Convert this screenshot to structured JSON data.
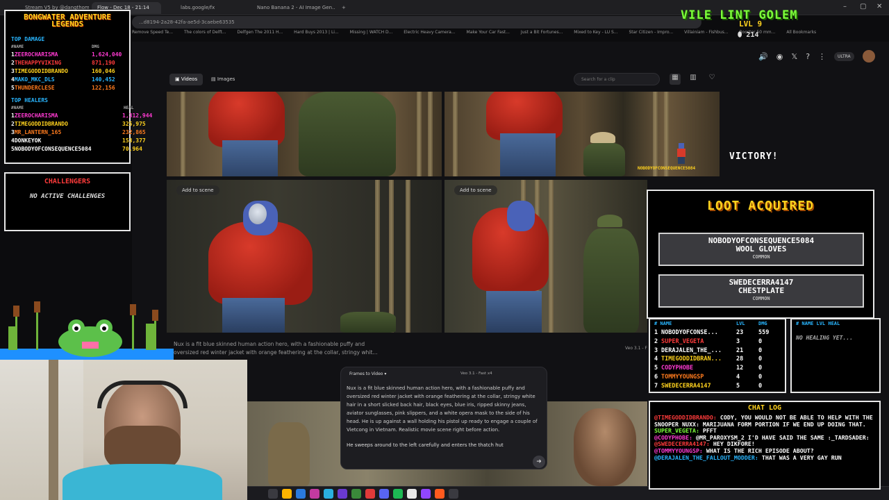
{
  "browser": {
    "tabs": [
      "Stream V5 by @dangthompson...",
      "Flow - Dec 18 - 21:14",
      "labs.google/fx",
      "Nano Banana 2 - AI Image Gen..."
    ],
    "url": "...d8194-2a28-42fa-ae5d-3caebe63535",
    "bookmarks": [
      "Remove Speed Te...",
      "The colors of Delft...",
      "Delfgen The 2011 H...",
      "Hard Buys 2013 | Li...",
      "Missing | WATCH D...",
      "Electric Heavy Camera...",
      "Make Your Car Fast...",
      "Just a Bit Fortunes...",
      "Mixed to Key - LU S...",
      "Star Citizen - Impro...",
      "Villainiam - Fishbus...",
      "Booster 50 mm..."
    ],
    "all_bookmarks": "All Bookmarks"
  },
  "app": {
    "tabs": {
      "videos": "Videos",
      "images": "Images"
    },
    "search_placeholder": "Search for a clip",
    "ultra_badge": "ULTRA",
    "add_to_scene": "Add to scene",
    "caption": "Nux is a fit blue skinned human action hero, with a fashionable puffy and oversized red winter jacket with orange feathering at the collar, stringy whit...",
    "veo_label": "Veo 3.1 - F",
    "prompt_panel": {
      "mode": "Frames to Video",
      "model": "Veo 3.1 - Fast      x4",
      "text": "Nux is a fit blue skinned human action hero, with a fashionable puffy and oversized red winter jacket with orange feathering at the collar, stringy white hair in a short slicked back hair, black eyes, blue iris, ripped skinny jeans, aviator sunglasses, pink slippers, and a white opera mask to the side of his head. He is up against a wall holding his pistol up ready to engage a couple of Vietcong in Vietnam. Realistic movie scene right before action.",
      "input": "He sweeps around to the left carefully and enters the thatch hut"
    }
  },
  "overlay": {
    "title": "BONGWATER ADVENTURE LEGENDS",
    "top_damage": {
      "heading": "TOP DAMAGE",
      "col_name": "NAME",
      "col_value": "DMG",
      "rows": [
        {
          "rank": "1",
          "name": "ZEEROCHARISMA",
          "value": "1,624,040",
          "color": "#ff3ad2"
        },
        {
          "rank": "2",
          "name": "THEHAPPYVIKING",
          "value": "871,190",
          "color": "#ff3b3b"
        },
        {
          "rank": "3",
          "name": "TIMEGODDIDBRANDO",
          "value": "160,046",
          "color": "#ffd21e"
        },
        {
          "rank": "4",
          "name": "MAKO_MKC_DLS",
          "value": "140,452",
          "color": "#29b6ff"
        },
        {
          "rank": "5",
          "name": "THUNDERCLESE",
          "value": "122,156",
          "color": "#ff7b1e"
        }
      ]
    },
    "top_healers": {
      "heading": "TOP HEALERS",
      "col_name": "NAME",
      "col_value": "HEAL",
      "rows": [
        {
          "rank": "1",
          "name": "ZEEROCHARISMA",
          "value": "1,312,944",
          "color": "#ff3ad2"
        },
        {
          "rank": "2",
          "name": "TIMEGODDIDBRANDO",
          "value": "325,975",
          "color": "#ffd21e"
        },
        {
          "rank": "3",
          "name": "MR_LANTERN_165",
          "value": "232,865",
          "color": "#ff7b1e"
        },
        {
          "rank": "4",
          "name": "DONKEYOK",
          "value": "153,377",
          "color": "#ffffff"
        },
        {
          "rank": "5",
          "name": "NOBODYOFCONSEQUENCE5084",
          "value": "70,964",
          "color": "#ffffff"
        }
      ]
    },
    "challenges": {
      "title": "CHALLENGERS",
      "body": "NO ACTIVE CHALLENGES"
    },
    "monster": {
      "name": "VILE LINT GOLEM",
      "level": "LVL 9",
      "xp": "214"
    },
    "victory": "VICTORY!",
    "floating_name": "NOBODYOFCONSEQUENCE5084",
    "loot": {
      "title": "LOOT ACQUIRED",
      "items": [
        {
          "player": "NOBODYOFCONSEQUENCE5084",
          "item": "WOOL GLOVES",
          "rarity": "COMMON"
        },
        {
          "player": "SWEDECERRA4147",
          "item": "CHESTPLATE",
          "rarity": "COMMON"
        }
      ]
    },
    "damage_table": {
      "headers": [
        "# NAME",
        "LVL",
        "DMG"
      ],
      "rows": [
        {
          "rank": "1",
          "name": "NOBODYOFCONSE...",
          "lvl": "23",
          "dmg": "559",
          "color": "#ffffff"
        },
        {
          "rank": "2",
          "name": "SUPER_VEGETA",
          "lvl": "3",
          "dmg": "0",
          "color": "#ff3b3b"
        },
        {
          "rank": "3",
          "name": "DERAJALEN_THE_...",
          "lvl": "21",
          "dmg": "0",
          "color": "#ffffff"
        },
        {
          "rank": "4",
          "name": "TIMEGODDIDBRAN...",
          "lvl": "28",
          "dmg": "0",
          "color": "#ffd21e"
        },
        {
          "rank": "5",
          "name": "CODYPHOBE",
          "lvl": "12",
          "dmg": "0",
          "color": "#ff3ad2"
        },
        {
          "rank": "6",
          "name": "TOMMYYOUNGSP",
          "lvl": "4",
          "dmg": "0",
          "color": "#ff7b1e"
        },
        {
          "rank": "7",
          "name": "SWEDECERRA4147",
          "lvl": "5",
          "dmg": "0",
          "color": "#ffd21e"
        }
      ]
    },
    "heal_table": {
      "headers": "# NAME LVL HEAL",
      "empty": "NO HEALING YET..."
    },
    "chat": {
      "title": "CHAT LOG",
      "lines": [
        {
          "user": "@TIMEGODDIDBRANDO:",
          "msg": " CODY, YOU WOULD NOT BE ABLE TO HELP WITH THE SNOOPER NUXX: MARIJUANA FORM PORTION IF WE END UP DOING THAT.",
          "color": "#ff3b3b"
        },
        {
          "user": "SUPER_VEGETA:",
          "msg": " PFFT",
          "color": "#7dff3a"
        },
        {
          "user": "@CODYPHOBE:",
          "msg": " @MR_PAROXYSM_2 I'D HAVE SAID THE SAME :_TARDSADER:",
          "color": "#ff3ad2"
        },
        {
          "user": "@SWEDECERRA4147:",
          "msg": " HEY DIKFORE!",
          "color": "#ff3b3b"
        },
        {
          "user": "@TOMMYYOUNGSP:",
          "msg": " WHAT IS THE RICH EPISODE ABOUT?",
          "color": "#ff3ad2"
        },
        {
          "user": "@DERAJALEN_THE_FALLOUT_MODDER:",
          "msg": " THAT WAS A VERY GAY RUN",
          "color": "#29b6ff"
        }
      ]
    }
  }
}
